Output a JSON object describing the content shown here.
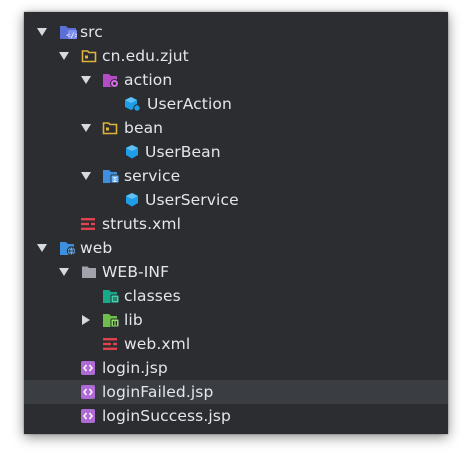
{
  "tree": {
    "src": "src",
    "package": "cn.edu.zjut",
    "action": "action",
    "user_action": "UserAction",
    "bean": "bean",
    "user_bean": "UserBean",
    "service": "service",
    "user_service": "UserService",
    "struts_xml": "struts.xml",
    "web": "web",
    "web_inf": "WEB-INF",
    "classes": "classes",
    "lib": "lib",
    "web_xml": "web.xml",
    "login_jsp": "login.jsp",
    "login_failed_jsp": "loginFailed.jsp",
    "login_success_jsp": "loginSuccess.jsp"
  },
  "selected_item": "loginFailed.jsp",
  "colors": {
    "panel_background": "#2b2d31",
    "selection": "#3a3d42",
    "text": "#e3e6ea",
    "source_folder": "#5b6fd6",
    "package_folder": "#e0b43a",
    "action_folder": "#b54cc5",
    "service_folder": "#3d8fe0",
    "class_icon": "#1e9ee8",
    "xml_icon": "#e0434b",
    "jsp_icon": "#b06ad6",
    "classes_folder": "#1aa88a",
    "lib_folder": "#6cc04a",
    "plain_folder": "#a0a4aa"
  }
}
